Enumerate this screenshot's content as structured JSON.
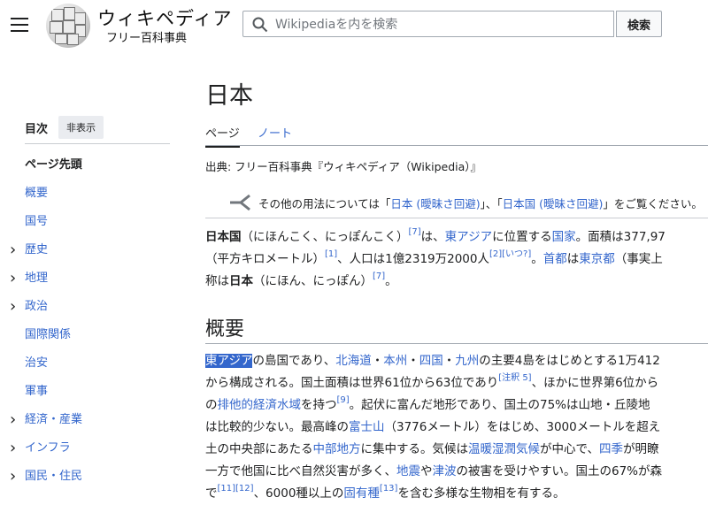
{
  "header": {
    "wordmark": "ウィキペディア",
    "tagline": "フリー百科事典",
    "search_placeholder": "Wikipediaを内を検索",
    "search_button": "検索"
  },
  "toc": {
    "title": "目次",
    "hide": "非表示",
    "top": "ページ先頭",
    "items": [
      {
        "label": "概要",
        "expandable": false
      },
      {
        "label": "国号",
        "expandable": false
      },
      {
        "label": "歴史",
        "expandable": true
      },
      {
        "label": "地理",
        "expandable": true
      },
      {
        "label": "政治",
        "expandable": true
      },
      {
        "label": "国際関係",
        "expandable": false
      },
      {
        "label": "治安",
        "expandable": false
      },
      {
        "label": "軍事",
        "expandable": false
      },
      {
        "label": "経済・産業",
        "expandable": true
      },
      {
        "label": "インフラ",
        "expandable": true
      },
      {
        "label": "国民・住民",
        "expandable": true
      }
    ]
  },
  "article": {
    "title": "日本",
    "tabs": {
      "page": "ページ",
      "talk": "ノート"
    },
    "from": "出典: フリー百科事典『ウィキペディア（Wikipedia）』",
    "hatnote": {
      "pre": "その他の用法については「",
      "link1": "日本 (曖昧さ回避)",
      "mid": "」、「",
      "link2": "日本国 (曖昧さ回避)",
      "post": "」をご覧ください。"
    },
    "lead": {
      "l1": {
        "b1": "日本国",
        "t1": "（にほんこく、にっぽんこく）",
        "s1": "[7]",
        "t2": "は、",
        "a1": "東アジア",
        "t3": "に位置する",
        "a2": "国家",
        "t4": "。面積は377,97"
      },
      "l2": {
        "t1": "（平方キロメートル）",
        "s1": "[1]",
        "t2": "、人口は1億2319万2000人",
        "s2": "[2][いつ?]",
        "t3": "。",
        "a1": "首都",
        "t4": "は",
        "a2": "東京都",
        "t5": "（事実上"
      },
      "l3": {
        "t1": "称は",
        "b1": "日本",
        "t2": "（にほん、にっぽん）",
        "s1": "[7]",
        "t3": "。"
      }
    },
    "section_heading": "概要",
    "overview": {
      "l1": {
        "sel": "東アジア",
        "t1": "の島国であり、",
        "a1": "北海道",
        "t2": "・",
        "a2": "本州",
        "t3": "・",
        "a3": "四国",
        "t4": "・",
        "a4": "九州",
        "t5": "の主要4島をはじめとする1万412"
      },
      "l2": {
        "t1": "から構成される。国土面積は世界61位から63位であり",
        "s1": "[注釈 5]",
        "t2": "、ほかに世界第6位から"
      },
      "l3": {
        "t1": "の",
        "a1": "排他的経済水域",
        "t2": "を持つ",
        "s1": "[9]",
        "t3": "。起伏に富んだ地形であり、国土の75%は山地・丘陵地"
      },
      "l4": {
        "t1": "は比較的少ない。最高峰の",
        "a1": "富士山",
        "t2": "（3776メートル）をはじめ、3000メートルを超え"
      },
      "l5": {
        "t1": "土の中央部にあたる",
        "a1": "中部地方",
        "t2": "に集中する。気候は",
        "a2": "温暖湿潤気候",
        "t3": "が中心で、",
        "a3": "四季",
        "t4": "が明瞭"
      },
      "l6": {
        "t1": "一方で他国に比べ自然災害が多く、",
        "a1": "地震",
        "t2": "や",
        "a2": "津波",
        "t3": "の被害を受けやすい。国土の67%が森"
      },
      "l7": {
        "t1": "で",
        "s1": "[11][12]",
        "t2": "、6000種以上の",
        "a1": "固有種",
        "s2": "[13]",
        "t3": "を含む多様な生物相を有する。"
      }
    }
  }
}
